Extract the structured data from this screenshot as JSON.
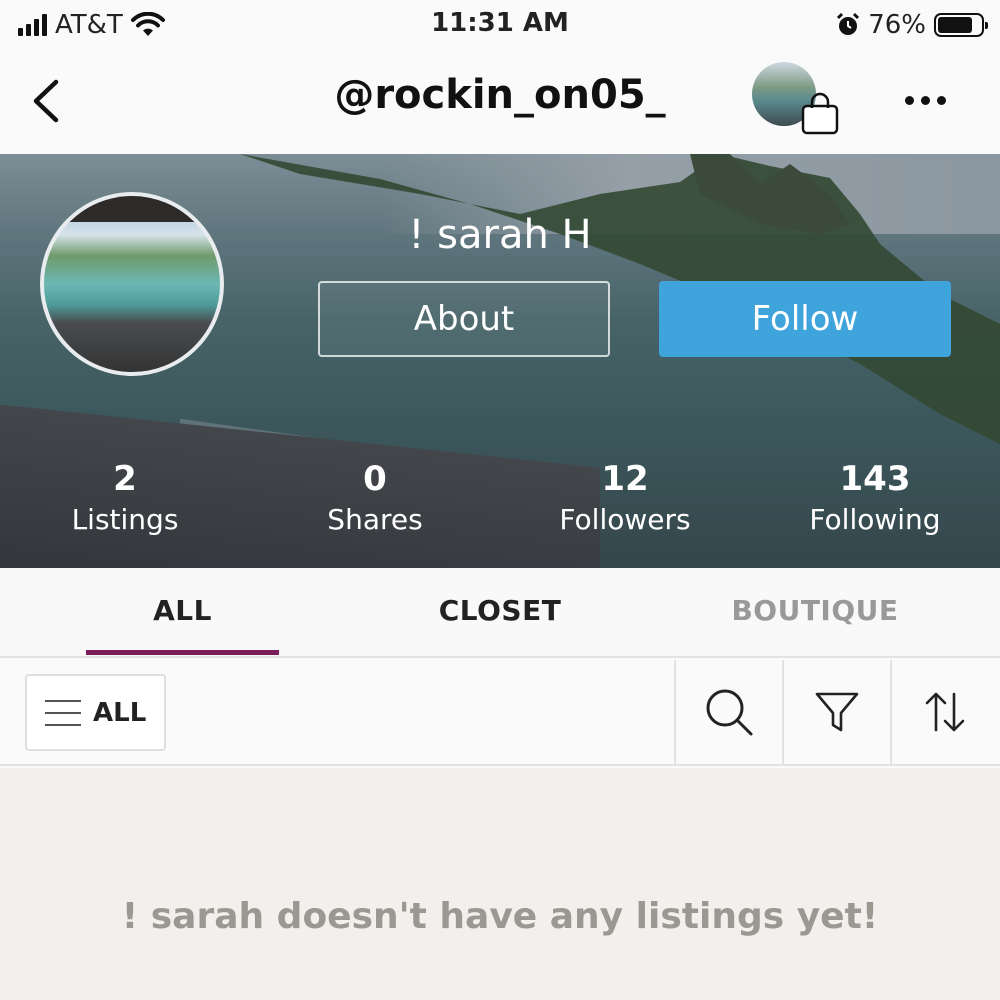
{
  "status_bar": {
    "carrier": "AT&T",
    "time": "11:31 AM",
    "battery": "76%",
    "icons": [
      "signal-icon",
      "wifi-icon",
      "alarm-icon",
      "battery-icon"
    ]
  },
  "nav": {
    "title": "@rockin_on05_",
    "icons": [
      "back-chevron-icon",
      "shopping-bag-icon",
      "more-dots-icon"
    ]
  },
  "profile": {
    "display_name": "! sarah H",
    "about_label": "About",
    "follow_label": "Follow",
    "stats": [
      {
        "value": "2",
        "label": "Listings"
      },
      {
        "value": "0",
        "label": "Shares"
      },
      {
        "value": "12",
        "label": "Followers"
      },
      {
        "value": "143",
        "label": "Following"
      }
    ]
  },
  "tabs": {
    "items": [
      {
        "label": "ALL",
        "active": true
      },
      {
        "label": "CLOSET",
        "active": false
      },
      {
        "label": "BOUTIQUE",
        "active": false
      }
    ]
  },
  "toolbar": {
    "filter_label": "ALL",
    "icons": [
      "menu-icon",
      "search-icon",
      "filter-funnel-icon",
      "sort-arrows-icon"
    ]
  },
  "empty_state": {
    "message": "! sarah doesn't have any listings yet!"
  },
  "colors": {
    "accent": "#3fa3dc",
    "tab_underline": "#7a1d5a",
    "muted_text": "#9b9892"
  }
}
